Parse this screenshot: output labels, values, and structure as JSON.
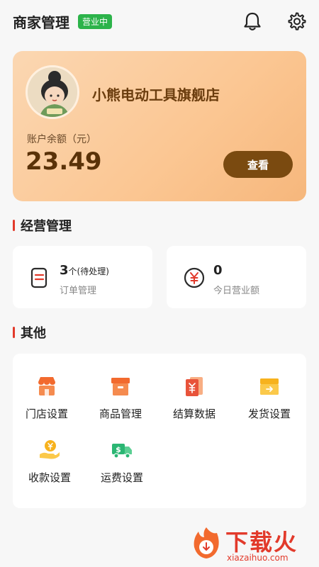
{
  "header": {
    "title": "商家管理",
    "status": "营业中"
  },
  "store": {
    "name": "小熊电动工具旗舰店",
    "balance_label": "账户余额（元）",
    "balance": "23.49",
    "view_label": "查看"
  },
  "operations": {
    "section_title": "经营管理",
    "orders": {
      "count": "3",
      "unit": "个(待处理)",
      "label": "订单管理"
    },
    "revenue": {
      "count": "0",
      "label": "今日营业额"
    }
  },
  "others": {
    "section_title": "其他",
    "items": [
      {
        "label": "门店设置",
        "icon": "store-icon"
      },
      {
        "label": "商品管理",
        "icon": "box-icon"
      },
      {
        "label": "结算数据",
        "icon": "settlement-icon"
      },
      {
        "label": "发货设置",
        "icon": "shipping-icon"
      },
      {
        "label": "收款设置",
        "icon": "payment-icon"
      },
      {
        "label": "运费设置",
        "icon": "freight-icon"
      }
    ]
  },
  "watermark": {
    "text": "下载火",
    "sub": "xiazaihuo.com"
  },
  "colors": {
    "badge": "#2cb34a",
    "accent": "#e23a2b",
    "button": "#7a4a10",
    "icon_orange": "#f26a2e",
    "icon_yellow": "#f7b21d",
    "icon_green": "#2bb673"
  }
}
